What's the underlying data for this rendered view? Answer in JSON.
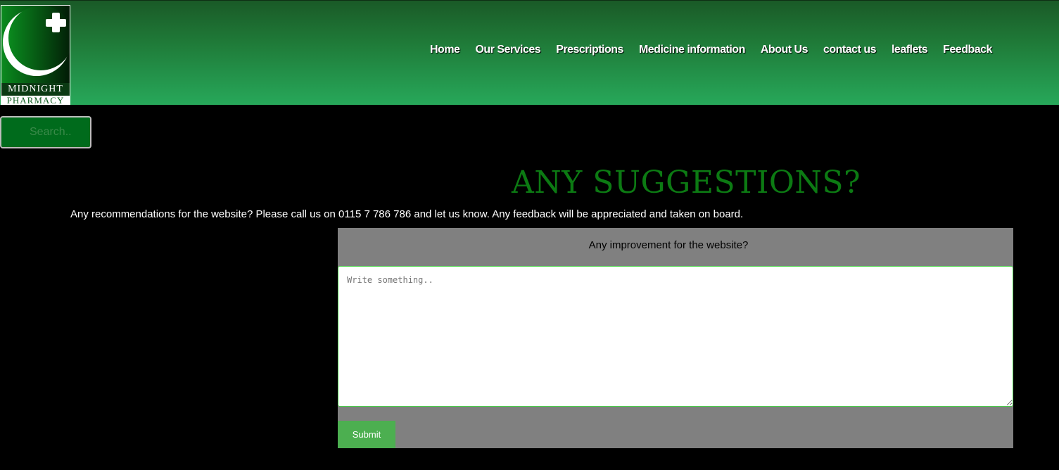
{
  "header": {
    "logo": {
      "line1": "MIDNIGHT",
      "line2": "PHARMACY"
    },
    "nav": [
      {
        "label": "Home"
      },
      {
        "label": "Our Services"
      },
      {
        "label": "Prescriptions"
      },
      {
        "label": "Medicine information"
      },
      {
        "label": "About Us"
      },
      {
        "label": "contact us"
      },
      {
        "label": "leaflets"
      },
      {
        "label": "Feedback"
      }
    ]
  },
  "search": {
    "placeholder": "Search.."
  },
  "main": {
    "title": "ANY SUGGESTIONS?",
    "description": "Any recommendations for the website? Please call us on 0115 7 786 786 and let us know. Any feedback will be appreciated and taken on board.",
    "form": {
      "label": "Any improvement for the website?",
      "placeholder": "Write something..",
      "submit_label": "Submit"
    }
  },
  "colors": {
    "header_top": "#1a5a27",
    "header_bottom": "#27a85a",
    "title": "#0c7a13",
    "submit": "#4caf50",
    "panel": "#808080"
  }
}
